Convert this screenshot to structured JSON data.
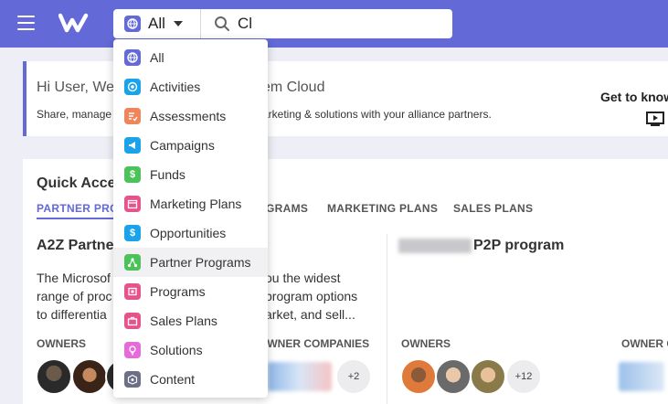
{
  "search": {
    "scope_label": "All",
    "query": "Cl"
  },
  "dropdown": {
    "items": [
      {
        "label": "All",
        "icon": "globe-icon",
        "color": "#6369d6"
      },
      {
        "label": "Activities",
        "icon": "activity-icon",
        "color": "#1aa3e8"
      },
      {
        "label": "Assessments",
        "icon": "assessment-icon",
        "color": "#f0845b"
      },
      {
        "label": "Campaigns",
        "icon": "megaphone-icon",
        "color": "#1aa3e8"
      },
      {
        "label": "Funds",
        "icon": "dollar-coin-icon",
        "color": "#4cc25a"
      },
      {
        "label": "Marketing Plans",
        "icon": "calendar-icon",
        "color": "#e8528b"
      },
      {
        "label": "Opportunities",
        "icon": "dollar-icon",
        "color": "#1aa3e8"
      },
      {
        "label": "Partner Programs",
        "icon": "network-icon",
        "color": "#4cc25a"
      },
      {
        "label": "Programs",
        "icon": "program-icon",
        "color": "#e8528b"
      },
      {
        "label": "Sales Plans",
        "icon": "briefcase-icon",
        "color": "#e8528b"
      },
      {
        "label": "Solutions",
        "icon": "lightbulb-icon",
        "color": "#e46bd8"
      },
      {
        "label": "Content",
        "icon": "content-box-icon",
        "color": "#6c6f86"
      }
    ],
    "highlighted_index": 7
  },
  "banner": {
    "title_start": "Hi User, We",
    "title_end": "em Cloud",
    "subtitle_start": "Share, manage",
    "subtitle_end": "arketing & solutions with your alliance partners.",
    "get_to_know": "Get to know"
  },
  "quick_access": {
    "title": "Quick Acce",
    "tabs": [
      "PARTNER PRO",
      "GRAMS",
      "MARKETING PLANS",
      "SALES PLANS"
    ],
    "active_tab_index": 0,
    "programs": [
      {
        "title": "A2Z Partne",
        "desc_left": [
          "The Microsof",
          "range of proc",
          "to differentia"
        ],
        "desc_right": [
          "ou the widest",
          "program options",
          "arket, and sell..."
        ],
        "owners_label": "OWNERS",
        "companies_label": "OWNER COMPANIES",
        "companies_more": "+2"
      },
      {
        "title": "P2P program",
        "owners_label": "OWNERS",
        "owners_more": "+12",
        "companies_label": "OWNER C"
      }
    ]
  },
  "colors": {
    "brand": "#6369d6",
    "background": "#eeeef6"
  }
}
